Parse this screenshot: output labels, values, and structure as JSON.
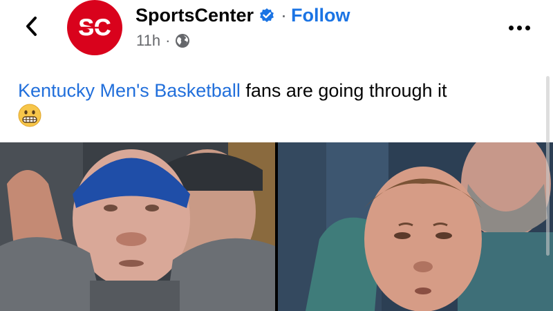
{
  "post": {
    "page_name": "SportsCenter",
    "avatar_text": "SC",
    "follow_label": "Follow",
    "separator": "·",
    "time": "11h",
    "text_link": "Kentucky Men's Basketball",
    "text_rest": " fans are going through it",
    "emoji": "grimacing-face-emoji"
  },
  "icons": {
    "back": "chevron-left-icon",
    "verified": "verified-badge-icon",
    "globe": "globe-icon",
    "more": "more-options-icon"
  },
  "colors": {
    "brand_red": "#d9021c",
    "link_blue": "#216fdb",
    "follow_blue": "#1b74e4",
    "meta_gray": "#65676b"
  },
  "media": {
    "images": [
      {
        "description": "fan-in-blue-cap-looking-up"
      },
      {
        "description": "fan-with-short-hair-looking-shocked"
      }
    ]
  }
}
